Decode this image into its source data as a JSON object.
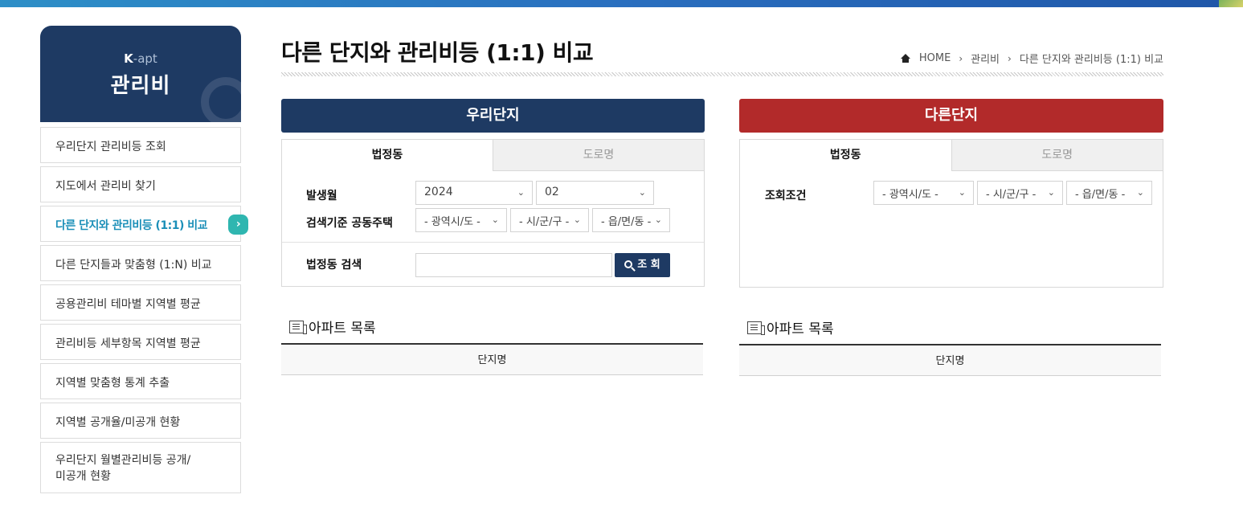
{
  "colors": {
    "navy": "#1e3a63",
    "red": "#b22a2a",
    "teal": "#2fb6b0",
    "link_active": "#1b8fb8"
  },
  "sidebar": {
    "brand_k": "K",
    "brand_rest": "-apt",
    "title": "관리비",
    "items": [
      {
        "label": "우리단지 관리비등 조회"
      },
      {
        "label": "지도에서 관리비 찾기"
      },
      {
        "label": "다른 단지와 관리비등 (1:1) 비교",
        "active": true
      },
      {
        "label": "다른 단지들과 맞춤형 (1:N) 비교"
      },
      {
        "label": "공용관리비 테마별 지역별 평균"
      },
      {
        "label": "관리비등 세부항목 지역별 평균"
      },
      {
        "label": "지역별 맞춤형 통계 추출"
      },
      {
        "label": "지역별 공개율/미공개 현황"
      },
      {
        "label_line1": "우리단지 월별관리비등 공개/",
        "label_line2": "미공개 현황"
      }
    ],
    "active_arrow": "›"
  },
  "header": {
    "title": "다른 단지와 관리비등 (1:1) 비교",
    "breadcrumb": [
      "HOME",
      "관리비",
      "다른 단지와 관리비등 (1:1) 비교"
    ],
    "breadcrumb_sep": "›"
  },
  "left_panel": {
    "heading": "우리단지",
    "tabs": [
      "법정동",
      "도로명"
    ],
    "issue_month_label": "발생월",
    "year": "2024",
    "month": "02",
    "base_label": "검색기준 공동주택",
    "sido": "- 광역시/도 -",
    "sigungu": "- 시/군/구 -",
    "dong": "- 읍/면/동 -",
    "search_label": "법정동 검색",
    "search_value": "",
    "search_button": "조 회",
    "list_title": "아파트 목록",
    "list_header": "단지명"
  },
  "right_panel": {
    "heading": "다른단지",
    "tabs": [
      "법정동",
      "도로명"
    ],
    "condition_label": "조회조건",
    "sido": "- 광역시/도 -",
    "sigungu": "- 시/군/구 -",
    "dong": "- 읍/면/동 -",
    "list_title": "아파트 목록",
    "list_header": "단지명"
  }
}
